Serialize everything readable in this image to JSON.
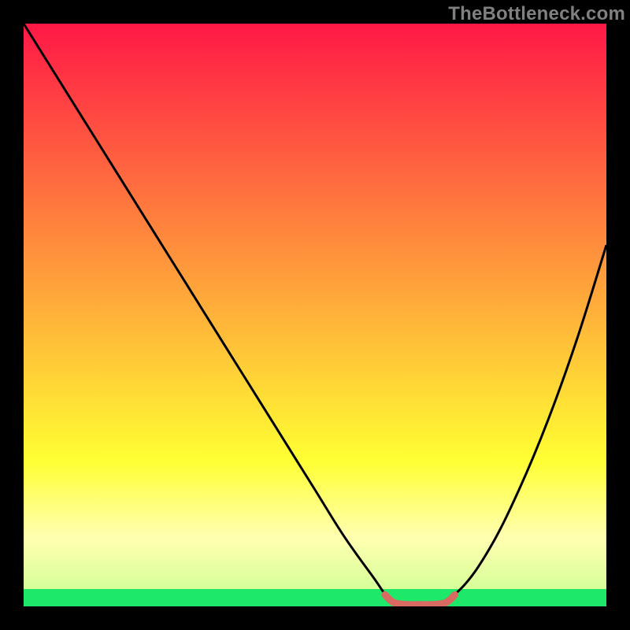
{
  "watermark": "TheBottleneck.com",
  "colors": {
    "top": "#ff1846",
    "mid_upper": "#ff8a2a",
    "mid": "#ffd400",
    "mid_lower": "#ffff33",
    "pale": "#ffffb0",
    "green": "#1ee86a",
    "curve": "#000000",
    "marker": "#d86a62"
  },
  "chart_data": {
    "type": "line",
    "title": "",
    "xlabel": "",
    "ylabel": "",
    "xlim": [
      0,
      100
    ],
    "ylim": [
      0,
      100
    ],
    "grid": false,
    "legend": false,
    "annotations": [
      "TheBottleneck.com"
    ],
    "series": [
      {
        "name": "bottleneck-curve",
        "x": [
          0,
          5,
          10,
          15,
          20,
          25,
          30,
          35,
          40,
          45,
          50,
          55,
          60,
          63,
          66,
          70,
          75,
          80,
          85,
          90,
          95,
          100
        ],
        "values": [
          100,
          92,
          84,
          76,
          68,
          60,
          52,
          44,
          36,
          28,
          20,
          12,
          5,
          1,
          0,
          0,
          3,
          10,
          20,
          32,
          46,
          62
        ]
      },
      {
        "name": "optimal-range-marker",
        "x": [
          62,
          63,
          64,
          66,
          68,
          70,
          72,
          73,
          74
        ],
        "values": [
          2.0,
          1.0,
          0.5,
          0.3,
          0.3,
          0.3,
          0.5,
          1.0,
          2.0
        ]
      }
    ],
    "gradient_bands": [
      {
        "y_from": 100,
        "y_to": 25,
        "type": "smooth",
        "from_color": "#ff1846",
        "to_color": "#ffff33"
      },
      {
        "y_from": 25,
        "y_to": 12,
        "type": "smooth",
        "from_color": "#ffff33",
        "to_color": "#ffffb0"
      },
      {
        "y_from": 12,
        "y_to": 3,
        "type": "banded",
        "from_color": "#ffffb0",
        "to_color": "#d8ff9a"
      },
      {
        "y_from": 3,
        "y_to": 0,
        "type": "solid",
        "color": "#1ee86a"
      }
    ]
  }
}
